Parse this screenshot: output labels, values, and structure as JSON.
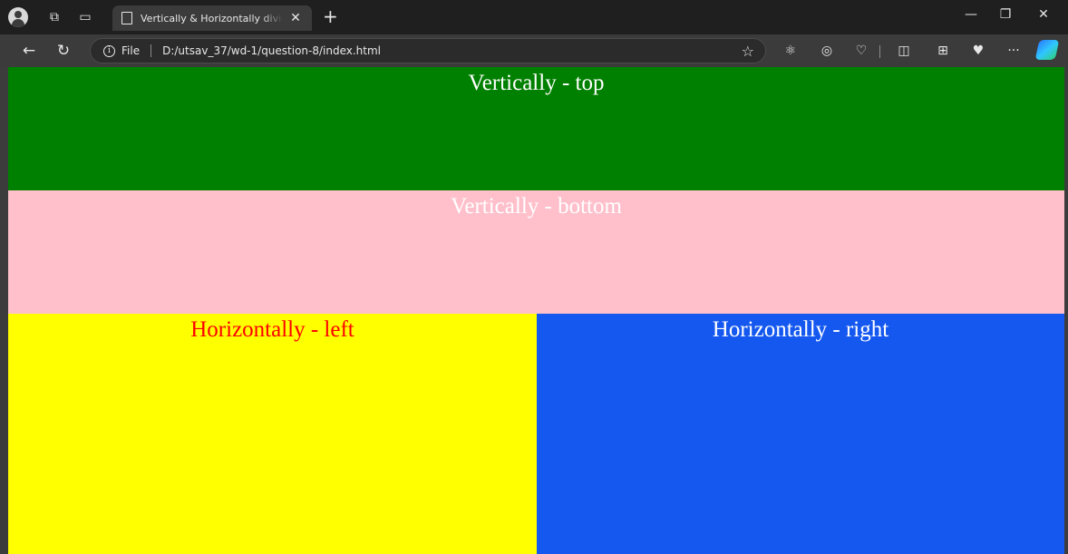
{
  "browser": {
    "tab": {
      "title": "Vertically & Horizontally divide page",
      "close": "✕"
    },
    "new_tab": "+",
    "window_controls": {
      "minimize": "—",
      "restore": "❐",
      "close": "✕"
    },
    "address": {
      "scheme_label": "File",
      "url": "D:/utsav_37/wd-1/question-8/index.html"
    },
    "icons": [
      "profile-icon",
      "workspaces-icon",
      "tab-actions-icon",
      "back-icon",
      "refresh-icon",
      "info-icon",
      "favorite-star-icon",
      "extension-icon",
      "circle-icon",
      "browser-essentials-icon",
      "split-screen-icon",
      "collections-icon",
      "health-icon",
      "more-icon",
      "copilot-icon"
    ],
    "more_label": "···"
  },
  "page": {
    "top": {
      "text": "Vertically - top",
      "bg": "#008000",
      "color": "#ffffff"
    },
    "bottom": {
      "text": "Vertically - bottom",
      "bg": "#ffc0cb",
      "color": "#ffffff"
    },
    "left": {
      "text": "Horizontally - left",
      "bg": "#ffff00",
      "color": "#ff0000"
    },
    "right": {
      "text": "Horizontally - right",
      "bg": "#1558f0",
      "color": "#ffffff"
    }
  }
}
